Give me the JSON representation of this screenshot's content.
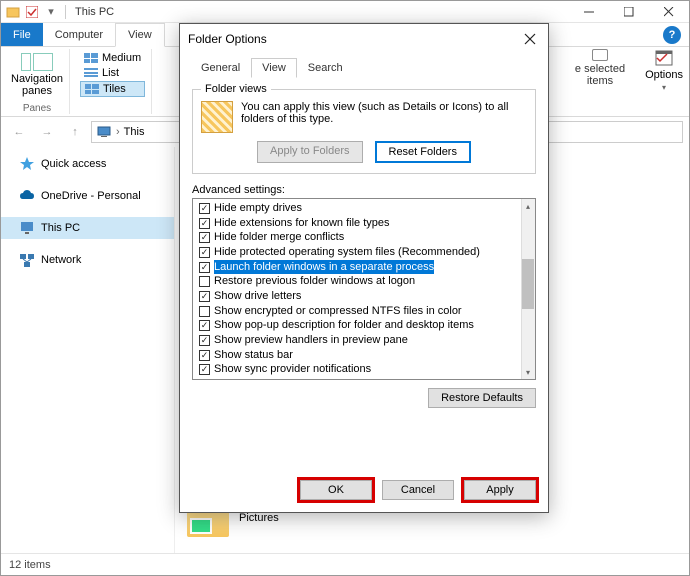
{
  "titlebar": {
    "title": "This PC"
  },
  "ribbon_tabs": {
    "file": "File",
    "computer": "Computer",
    "view": "View"
  },
  "ribbon": {
    "navpanes": "Navigation\npanes",
    "panes_label": "Panes",
    "medium": "Medium",
    "list": "List",
    "tiles": "Tiles",
    "hide_selected": "e selected\nitems",
    "options": "Options"
  },
  "address": {
    "this": "This"
  },
  "sidebar": {
    "items": [
      {
        "label": "Quick access"
      },
      {
        "label": "OneDrive - Personal"
      },
      {
        "label": "This PC"
      },
      {
        "label": "Network"
      }
    ]
  },
  "content": {
    "pictures": "Pictures"
  },
  "statusbar": {
    "text": "12 items"
  },
  "dialog": {
    "title": "Folder Options",
    "tabs": {
      "general": "General",
      "view": "View",
      "search": "Search"
    },
    "folder_views": {
      "legend": "Folder views",
      "text": "You can apply this view (such as Details or Icons) to all folders of this type.",
      "apply": "Apply to Folders",
      "reset": "Reset Folders"
    },
    "advanced_label": "Advanced settings:",
    "settings": [
      {
        "checked": true,
        "label": "Hide empty drives"
      },
      {
        "checked": true,
        "label": "Hide extensions for known file types"
      },
      {
        "checked": true,
        "label": "Hide folder merge conflicts"
      },
      {
        "checked": true,
        "label": "Hide protected operating system files (Recommended)"
      },
      {
        "checked": true,
        "label": "Launch folder windows in a separate process",
        "highlight": true
      },
      {
        "checked": false,
        "label": "Restore previous folder windows at logon"
      },
      {
        "checked": true,
        "label": "Show drive letters"
      },
      {
        "checked": false,
        "label": "Show encrypted or compressed NTFS files in color"
      },
      {
        "checked": true,
        "label": "Show pop-up description for folder and desktop items"
      },
      {
        "checked": true,
        "label": "Show preview handlers in preview pane"
      },
      {
        "checked": true,
        "label": "Show status bar"
      },
      {
        "checked": true,
        "label": "Show sync provider notifications"
      }
    ],
    "restore_defaults": "Restore Defaults",
    "ok": "OK",
    "cancel": "Cancel",
    "apply": "Apply"
  }
}
